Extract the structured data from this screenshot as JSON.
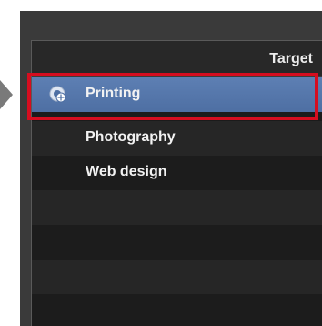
{
  "list": {
    "header": "Target",
    "items": [
      {
        "label": "Printing",
        "selected": true,
        "icon": "target-cursor-icon"
      },
      {
        "label": "Photography",
        "selected": false
      },
      {
        "label": "Web design",
        "selected": false
      }
    ]
  },
  "colors": {
    "selection": "#5672a6",
    "highlight_frame": "#d60d1f",
    "panel": "#1b1b1b",
    "text": "#f2f2f2"
  }
}
